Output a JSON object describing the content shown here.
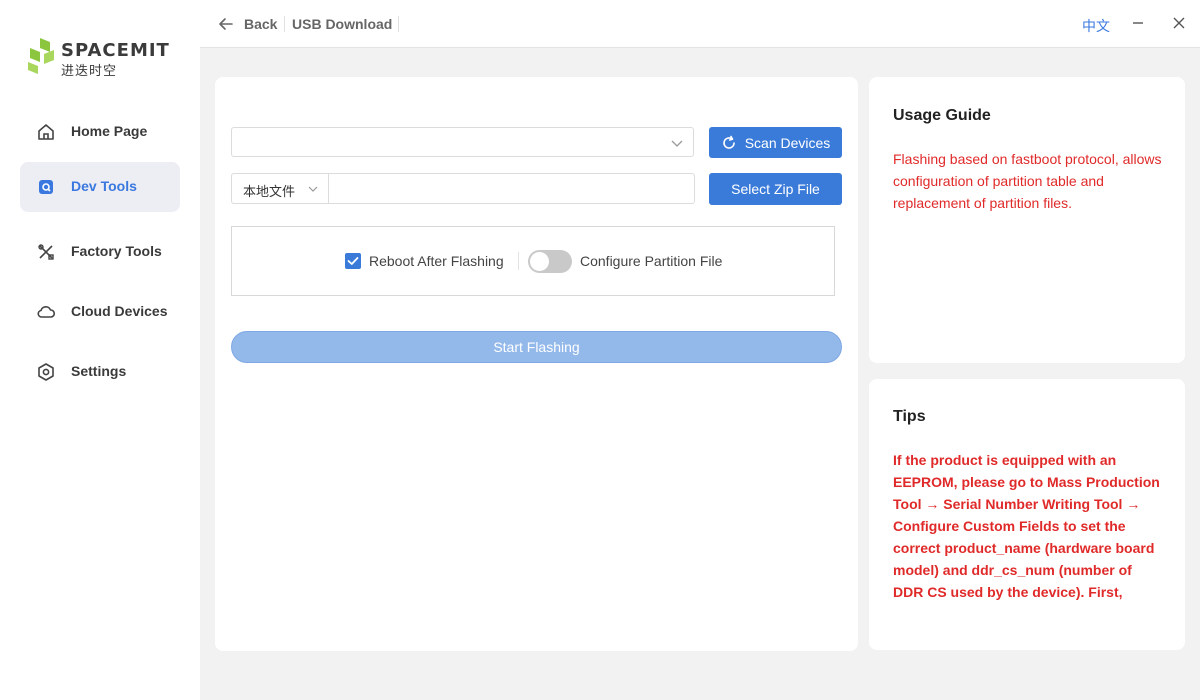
{
  "sidebar": {
    "logo_text": "SPACEMIT",
    "logo_sub": "进迭时空",
    "items": [
      {
        "label": "Home Page",
        "icon": "home-icon"
      },
      {
        "label": "Dev Tools",
        "icon": "dev-tools-icon"
      },
      {
        "label": "Factory Tools",
        "icon": "tools-icon"
      },
      {
        "label": "Cloud Devices",
        "icon": "cloud-icon"
      },
      {
        "label": "Settings",
        "icon": "settings-icon"
      }
    ],
    "active_index": 1
  },
  "topbar": {
    "back_label": "Back",
    "title": "USB Download",
    "language": "中文"
  },
  "main": {
    "device_select_value": "",
    "scan_button": "Scan Devices",
    "source_select": "本地文件",
    "file_path_value": "",
    "select_zip_button": "Select Zip File",
    "reboot_label": "Reboot After Flashing",
    "reboot_checked": true,
    "partition_label": "Configure Partition File",
    "partition_enabled": false,
    "start_button": "Start Flashing"
  },
  "usage_guide": {
    "title": "Usage Guide",
    "text": "Flashing based on fastboot protocol, allows configuration of partition table and replacement of partition files."
  },
  "tips": {
    "title": "Tips",
    "text": "If the product is equipped with an EEPROM, please go to Mass Production Tool → Serial Number Writing Tool → Configure Custom Fields to set the correct product_name (hardware board model) and ddr_cs_num (number of DDR CS used by the device). First, perform"
  },
  "colors": {
    "accent": "#3a7bd9",
    "warning_text": "#e02a2a",
    "logo_green": "#8cc63f"
  }
}
